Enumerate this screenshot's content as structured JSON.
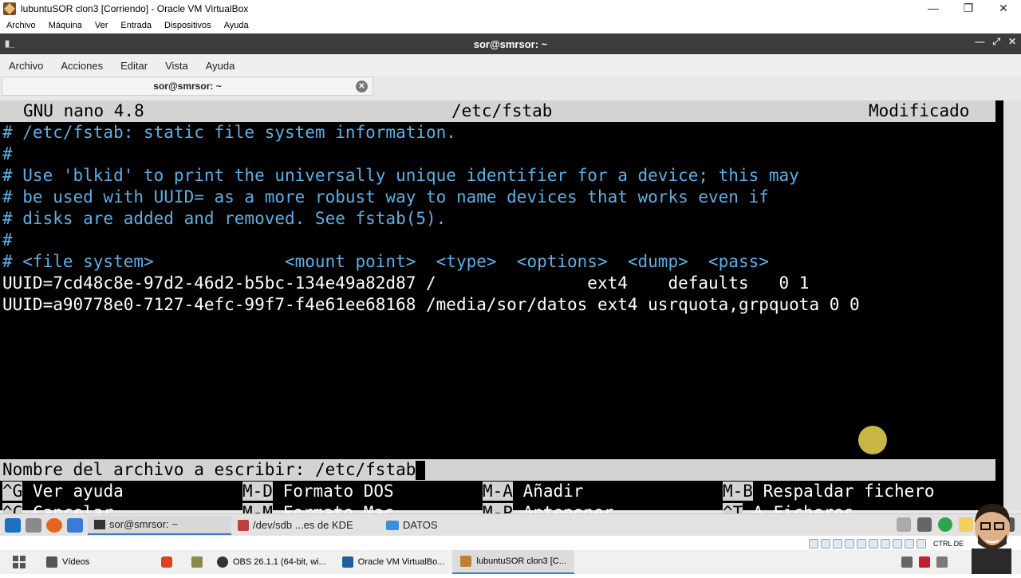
{
  "host_window": {
    "title": "lubuntuSOR clon3 [Corriendo] - Oracle VM VirtualBox",
    "menu": [
      "Archivo",
      "Máquina",
      "Ver",
      "Entrada",
      "Dispositivos",
      "Ayuda"
    ]
  },
  "terminal_window": {
    "title": "sor@smrsor: ~",
    "menu": [
      "Archivo",
      "Acciones",
      "Editar",
      "Vista",
      "Ayuda"
    ],
    "tab_label": "sor@smrsor: ~"
  },
  "nano": {
    "version": "GNU nano 4.8",
    "filename": "/etc/fstab",
    "status": "Modificado",
    "lines": [
      "# /etc/fstab: static file system information.",
      "#",
      "# Use 'blkid' to print the universally unique identifier for a device; this may",
      "# be used with UUID= as a more robust way to name devices that works even if",
      "# disks are added and removed. See fstab(5).",
      "#",
      "# <file system>             <mount point>  <type>  <options>  <dump>  <pass>",
      "UUID=7cd48c8e-97d2-46d2-b5bc-134e49a82d87 /               ext4    defaults   0 1",
      "UUID=a90778e0-7127-4efc-99f7-f4e61ee68168 /media/sor/datos ext4 usrquota,grpquota 0 0"
    ],
    "prompt_label": "Nombre del archivo a escribir: ",
    "prompt_value": "/etc/fstab",
    "shortcuts": [
      {
        "key": "^G",
        "label": "Ver ayuda"
      },
      {
        "key": "M-D",
        "label": "Formato DOS"
      },
      {
        "key": "M-A",
        "label": "Añadir"
      },
      {
        "key": "M-B",
        "label": "Respaldar fichero"
      },
      {
        "key": "^C",
        "label": "Cancelar"
      },
      {
        "key": "M-M",
        "label": "Formato Mac"
      },
      {
        "key": "M-P",
        "label": "Anteponer"
      },
      {
        "key": "^T",
        "label": "A Ficheros"
      }
    ]
  },
  "guest_taskbar": {
    "tasks": [
      "sor@smrsor: ~",
      "/dev/sdb ...es de KDE",
      "DATOS"
    ]
  },
  "host_taskbar": {
    "tasks": [
      "Vídeos",
      "OBS 26.1.1 (64-bit, wi...",
      "Oracle VM VirtualBo...",
      "lubuntuSOR clon3 [C..."
    ],
    "host_key": "CTRL DE"
  },
  "colors": {
    "terminal_bg": "#000000",
    "comment": "#5ab0e8",
    "nano_bar": "#d3d3d3",
    "title_bar": "#3c3c3c"
  }
}
